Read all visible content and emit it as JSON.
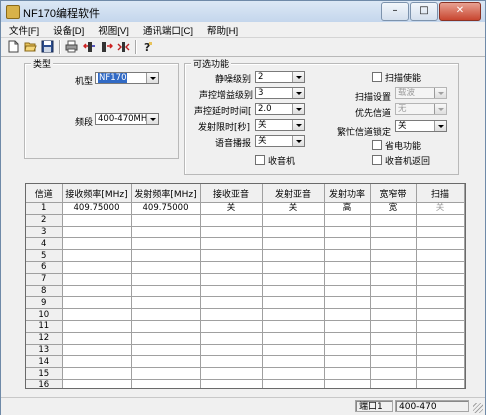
{
  "window": {
    "title": "NF170编程软件",
    "minimize": "–",
    "maximize": "□",
    "close": "✕"
  },
  "menu": [
    "文件[F]",
    "设备[D]",
    "视图[V]",
    "通讯端口[C]",
    "帮助[H]"
  ],
  "toolbar": [
    "new-file",
    "open-folder",
    "save",
    "print",
    "read-radio",
    "write-radio",
    "send",
    "help"
  ],
  "type_group": {
    "title": "类型",
    "model_label": "机型",
    "model_value": "NF170",
    "band_label": "频段",
    "band_value": "400-470MHz"
  },
  "options": {
    "title": "可选功能",
    "squelch_label": "静噪级别",
    "squelch_value": "2",
    "vox_gain_label": "声控增益级别",
    "vox_gain_value": "3",
    "vox_delay_label": "声控延时时间[",
    "vox_delay_value": "2.0",
    "tx_limit_label": "发射限时[秒]",
    "tx_limit_value": "关",
    "voice_label": "语音播报",
    "voice_value": "关",
    "radio_label": "收音机",
    "scan_enable_label": "扫描使能",
    "scan_setting_label": "扫描设置",
    "scan_setting_value": "载波",
    "priority_label": "优先信道",
    "priority_value": "无",
    "busy_lock_label": "繁忙信道锁定",
    "busy_lock_value": "关",
    "power_save_label": "省电功能",
    "radio_return_label": "收音机返回"
  },
  "table": {
    "headers": [
      "信道",
      "接收频率[MHz]",
      "发射频率[MHz]",
      "接收亚音",
      "发射亚音",
      "发射功率",
      "宽窄带",
      "扫描"
    ],
    "rows": [
      [
        "1",
        "409.75000",
        "409.75000",
        "关",
        "关",
        "高",
        "宽",
        "关"
      ],
      [
        "2",
        "",
        "",
        "",
        "",
        "",
        "",
        ""
      ],
      [
        "3",
        "",
        "",
        "",
        "",
        "",
        "",
        ""
      ],
      [
        "4",
        "",
        "",
        "",
        "",
        "",
        "",
        ""
      ],
      [
        "5",
        "",
        "",
        "",
        "",
        "",
        "",
        ""
      ],
      [
        "6",
        "",
        "",
        "",
        "",
        "",
        "",
        ""
      ],
      [
        "7",
        "",
        "",
        "",
        "",
        "",
        "",
        ""
      ],
      [
        "8",
        "",
        "",
        "",
        "",
        "",
        "",
        ""
      ],
      [
        "9",
        "",
        "",
        "",
        "",
        "",
        "",
        ""
      ],
      [
        "10",
        "",
        "",
        "",
        "",
        "",
        "",
        ""
      ],
      [
        "11",
        "",
        "",
        "",
        "",
        "",
        "",
        ""
      ],
      [
        "12",
        "",
        "",
        "",
        "",
        "",
        "",
        ""
      ],
      [
        "13",
        "",
        "",
        "",
        "",
        "",
        "",
        ""
      ],
      [
        "14",
        "",
        "",
        "",
        "",
        "",
        "",
        ""
      ],
      [
        "15",
        "",
        "",
        "",
        "",
        "",
        "",
        ""
      ],
      [
        "16",
        "",
        "",
        "",
        "",
        "",
        "",
        ""
      ]
    ]
  },
  "status": {
    "port": "端口1",
    "band": "400-470"
  }
}
